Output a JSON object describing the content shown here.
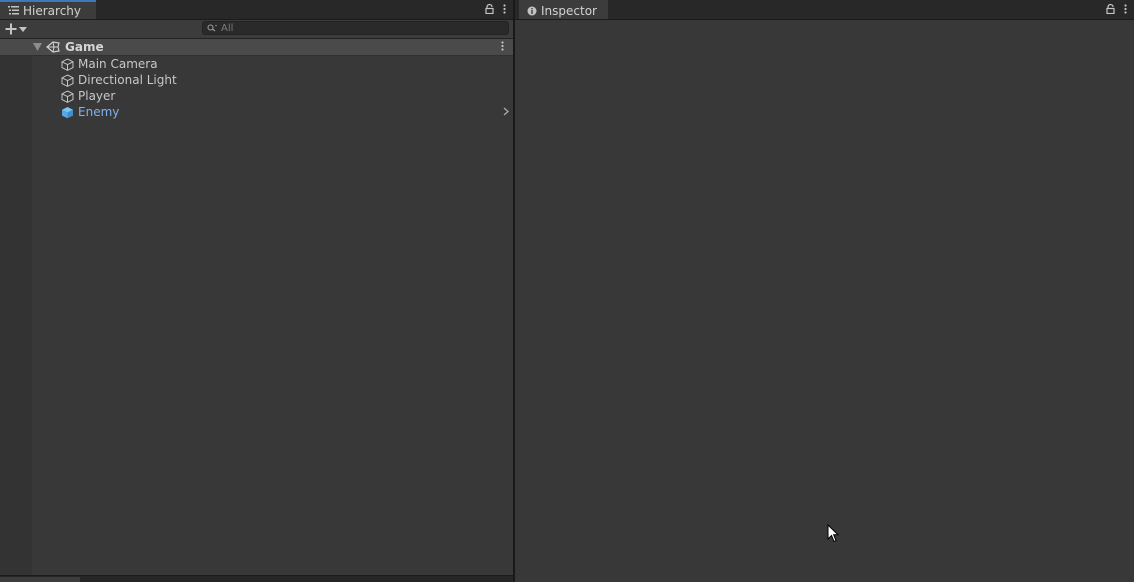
{
  "hierarchy": {
    "tab_label": "Hierarchy",
    "search_placeholder": "All",
    "scene": {
      "name": "Game"
    },
    "items": [
      {
        "label": "Main Camera",
        "type": "gameobject"
      },
      {
        "label": "Directional Light",
        "type": "gameobject"
      },
      {
        "label": "Player",
        "type": "gameobject"
      },
      {
        "label": "Enemy",
        "type": "prefab"
      }
    ]
  },
  "inspector": {
    "tab_label": "Inspector"
  },
  "colors": {
    "accent": "#3a79bb",
    "prefab_text": "#7fb2f0",
    "prefab_icon": "#58a9e8",
    "panel_bg": "#383838"
  },
  "icons": {
    "hierarchy_tab": "list-icon",
    "inspector_tab": "info-icon",
    "lock": "lock-icon",
    "menu": "kebab-menu-icon",
    "add": "plus-icon",
    "search": "search-icon",
    "scene": "unity-scene-icon",
    "gameobject": "cube-outline-icon",
    "prefab": "prefab-cube-icon",
    "expand": "chevron-right-icon"
  }
}
